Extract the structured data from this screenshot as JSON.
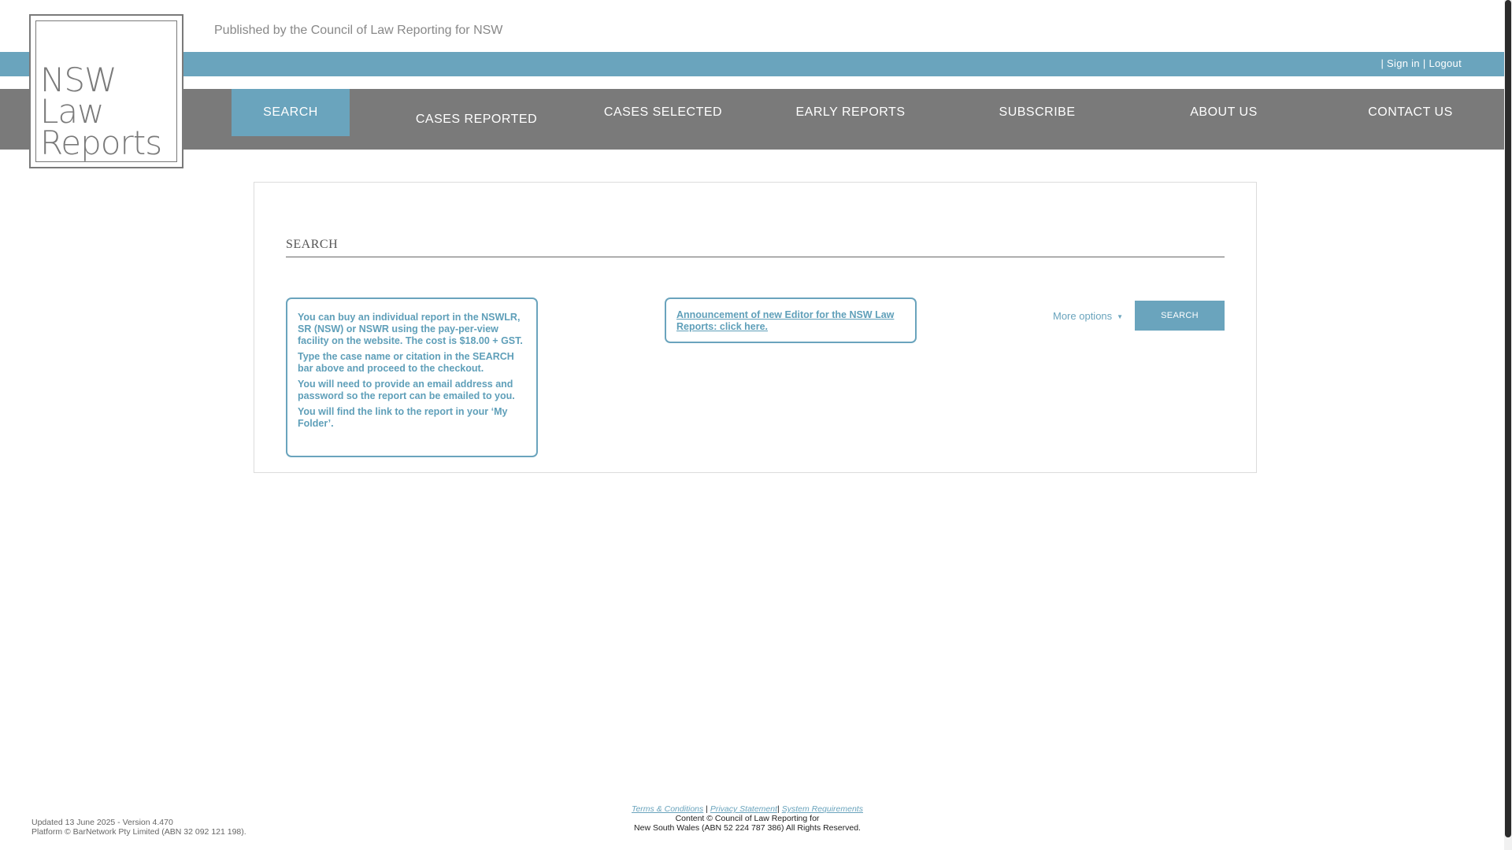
{
  "header": {
    "publisher_text": "Published by the Council of Law Reporting for NSW",
    "logo": {
      "line1": "NSW",
      "line2": "Law",
      "line3": "Reports"
    },
    "auth": {
      "separator": "|",
      "sign_in": "Sign in",
      "logout": "Logout"
    }
  },
  "nav": {
    "items": [
      {
        "label": "SEARCH",
        "active": true
      },
      {
        "label": "CASES REPORTED",
        "active": false
      },
      {
        "label": "CASES SELECTED",
        "active": false
      },
      {
        "label": "EARLY REPORTS",
        "active": false
      },
      {
        "label": "SUBSCRIBE",
        "active": false
      },
      {
        "label": "ABOUT US",
        "active": false
      },
      {
        "label": "CONTACT US",
        "active": false
      }
    ]
  },
  "main": {
    "heading": "SEARCH",
    "info_box": {
      "paragraphs": [
        "You can buy an individual report in the NSWLR, SR (NSW) or NSWR using the pay-per-view facility on the website. The cost is $18.00 + GST.",
        "Type the case name or citation in the SEARCH bar above and proceed to the checkout.",
        "You will need to provide an email address and password so the report can be emailed to you.",
        "You will find the link to the report in your ‘My Folder’."
      ]
    },
    "announcement": {
      "link_text": "Announcement of new Editor for the NSW Law Reports: click here."
    },
    "more_options_label": "More options",
    "more_options_caret": "▼",
    "search_button_label": "SEARCH"
  },
  "footer": {
    "updated": "Updated 13 June 2025 - Version 4.470",
    "platform": "Platform © BarNetwork Pty Limited (ABN 32 092 121 198).",
    "links": {
      "terms": "Terms & Conditions",
      "privacy": "Privacy Statement",
      "system": "System Requirements",
      "sep": "|"
    },
    "content_line1": "Content © Council of Law Reporting for",
    "content_line2": "New South Wales (ABN 52 224 787 386) All Rights Reserved."
  },
  "colors": {
    "accent": "#6aa4bd",
    "nav_background": "#7a7a7a",
    "info_text": "#5f9fb9"
  }
}
